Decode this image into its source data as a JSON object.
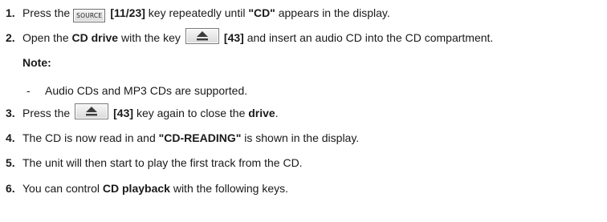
{
  "steps": [
    {
      "number": "1.",
      "parts": {
        "a": "Press the",
        "key_label": "SOURCE",
        "b": "[11/23]",
        "c": "key repeatedly until",
        "d": "\"CD\"",
        "e": "appears in the display."
      }
    },
    {
      "number": "2.",
      "parts": {
        "a": "Open the",
        "b": "CD drive",
        "c": "with the key",
        "d": "[43]",
        "e": "and insert an audio CD into the CD compartment."
      }
    },
    {
      "number": "3.",
      "parts": {
        "a": "Press the",
        "b": "[43]",
        "c": "key again to close the",
        "d": "drive",
        "e": "."
      }
    },
    {
      "number": "4.",
      "parts": {
        "a": "The CD is now read in and",
        "b": "\"CD-READING\"",
        "c": "is shown in the display."
      }
    },
    {
      "number": "5.",
      "parts": {
        "a": "The unit will then start to play the first track from the CD."
      }
    },
    {
      "number": "6.",
      "parts": {
        "a": "You can control",
        "b": "CD playback",
        "c": "with the following keys."
      }
    }
  ],
  "note": {
    "label": "Note:",
    "bullets": [
      {
        "dash": "-",
        "text": "Audio CDs and MP3 CDs are supported."
      }
    ]
  },
  "icons": {
    "source_key": "source-key-icon",
    "eject_key": "eject-key-icon"
  }
}
